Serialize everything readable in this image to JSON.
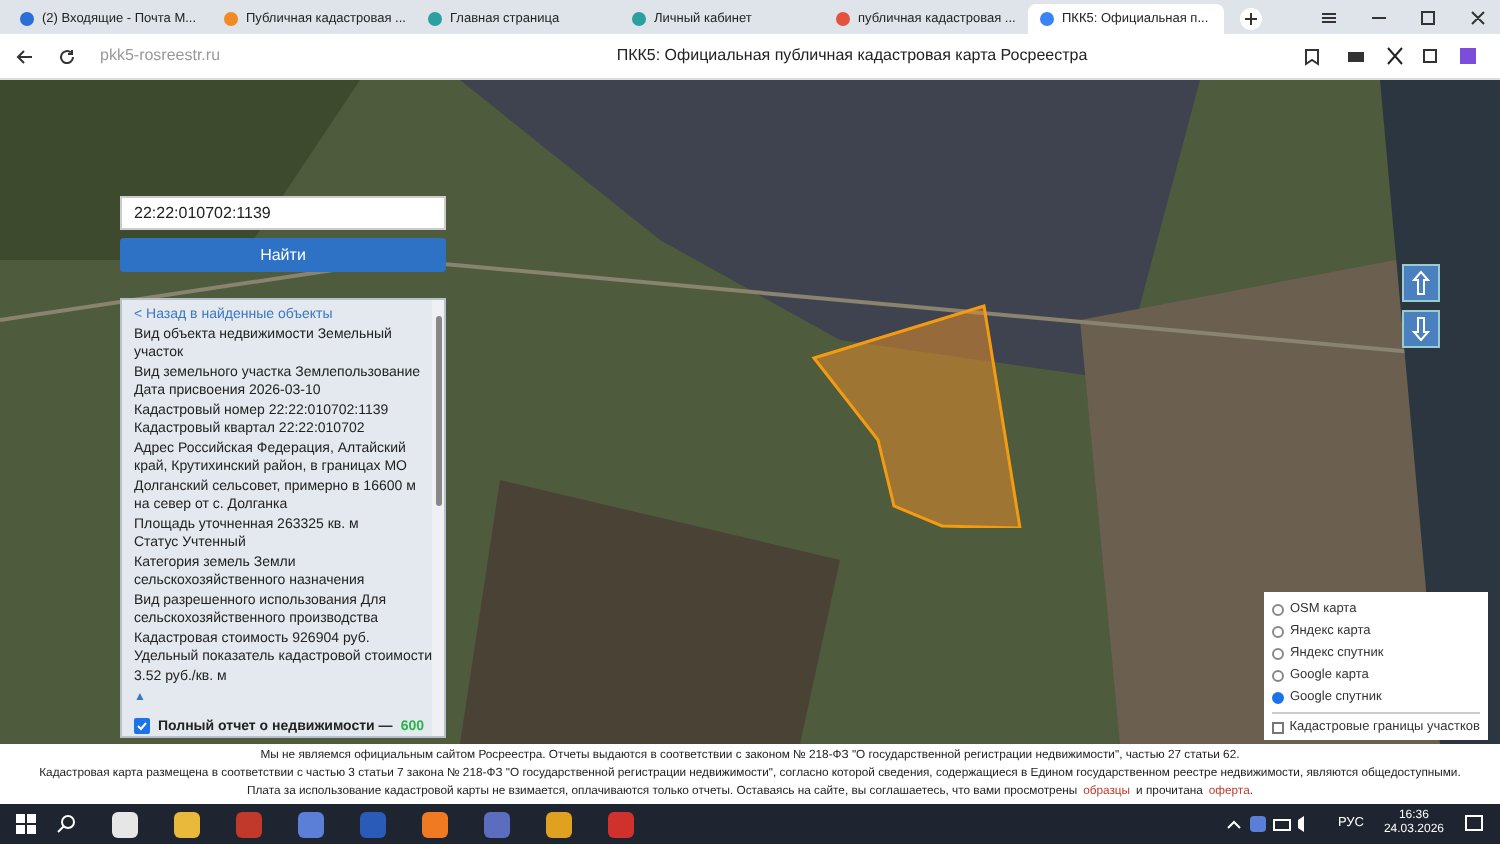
{
  "tabs": [
    {
      "label": "(2) Входящие - Почта M...",
      "selected": false,
      "color": "#2a6fd6"
    },
    {
      "label": "Публичная кадастровая ...",
      "selected": false,
      "color": "#f08a24"
    },
    {
      "label": "Главная страница",
      "selected": false,
      "color": "#2aa0a0"
    },
    {
      "label": "Личный кабинет",
      "selected": false,
      "color": "#2aa0a0"
    },
    {
      "label": "публичная кадастровая ...",
      "selected": false,
      "color": "#e5533d"
    },
    {
      "label": "ПКК5: Официальная п...",
      "selected": true,
      "color": "#3b82f6"
    }
  ],
  "address": {
    "url": "pkk5-rosreestr.ru",
    "page_title": "ПКК5: Официальная публичная кадастровая карта Росреестра"
  },
  "search": {
    "value": "22:22:010702:1139",
    "button": "Найти"
  },
  "info": {
    "back_link": "< Назад в найденные объекты",
    "lines": [
      "Вид объекта недвижимости Земельный участок",
      "Вид земельного участка Землепользование",
      "Дата присвоения 2026-03-10",
      "Кадастровый номер 22:22:010702:1139",
      "Кадастровый квартал 22:22:010702",
      "Адрес Российская Федерация, Алтайский край, Крутихинский район, в границах МО Долганский сельсовет, примерно в 16600 м на север от с. Долганка",
      "Площадь уточненная 263325 кв. м",
      "Статус Учтенный",
      "Категория земель Земли сельскохозяйственного назначения",
      "Вид разрешенного использования Для сельскохозяйственного производства",
      "Кадастровая стоимость 926904 руб.",
      "Удельный показатель кадастровой стоимости 3.52 руб./кв. м"
    ],
    "collapse": "▲",
    "report": {
      "checked": true,
      "label": "Полный отчет о недвижимости —",
      "price": "600"
    }
  },
  "layers": [
    {
      "label": "OSM карта",
      "selected": false
    },
    {
      "label": "Яндекс карта",
      "selected": false
    },
    {
      "label": "Яндекс спутник",
      "selected": false
    },
    {
      "label": "Google карта",
      "selected": false
    },
    {
      "label": "Google спутник",
      "selected": true
    }
  ],
  "boundaries": {
    "label": "Кадастровые границы участков",
    "checked": false
  },
  "footer": {
    "lines": [
      "Мы не являемся официальным сайтом Росреестра. Отчеты выдаются в соответствии с законом № 218-ФЗ \"О государственной регистрации недвижимости\", частью 27 статьи 62.",
      "Кадастровая карта размещена в соответствии с частью 3 статьи 7 закона № 218-ФЗ \"О государственной регистрации недвижимости\", согласно которой сведения, содержащиеся в Едином государственном реестре недвижимости, являются общедоступными."
    ],
    "notice": {
      "before": "Плата за использование кадастровой карты не взимается, оплачиваются только отчеты. Оставаясь на сайте, вы соглашаетесь, что вами просмотрены",
      "link1": "образцы",
      "middle": "и прочитана",
      "link2": "оферта",
      "after": "."
    }
  },
  "taskbar": {
    "lang": "РУС",
    "time": "16:36",
    "date": "24.03.2026"
  }
}
